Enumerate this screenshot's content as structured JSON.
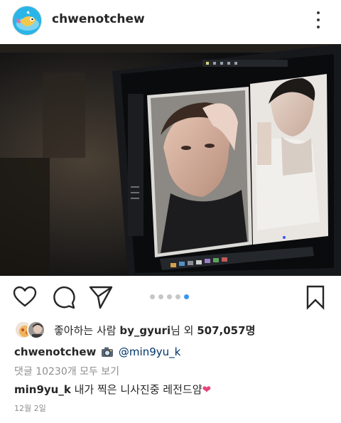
{
  "post": {
    "username": "chwenotchew",
    "avatar": "avatar-illustration",
    "more_icon": "more-vertical-icon",
    "image": "photo-of-monitor-showing-portraits"
  },
  "actions": {
    "like_icon": "heart-icon",
    "comment_icon": "comment-icon",
    "share_icon": "send-icon",
    "save_icon": "bookmark-icon",
    "carousel": {
      "count": 5,
      "active_index": 4,
      "active_color": "#3897f0"
    }
  },
  "likes": {
    "prefix": "좋아하는 사람 ",
    "user": "by_gyuri",
    "middle": "님 외 ",
    "count": "507,057",
    "suffix": "명"
  },
  "caption": {
    "username": "chwenotchew",
    "camera_icon": "camera-emoji",
    "mention": "@min9yu_k"
  },
  "comments": {
    "view_all": "댓글 10230개 모두 보기"
  },
  "comment": {
    "username": "min9yu_k",
    "text": " 내가 찍은 니사진중 레전드얌",
    "heart": "❤"
  },
  "date": "12월 2일",
  "colors": {
    "text": "#262626",
    "muted": "#8e8e8e",
    "link": "#003569",
    "heart": "#e8457c"
  }
}
